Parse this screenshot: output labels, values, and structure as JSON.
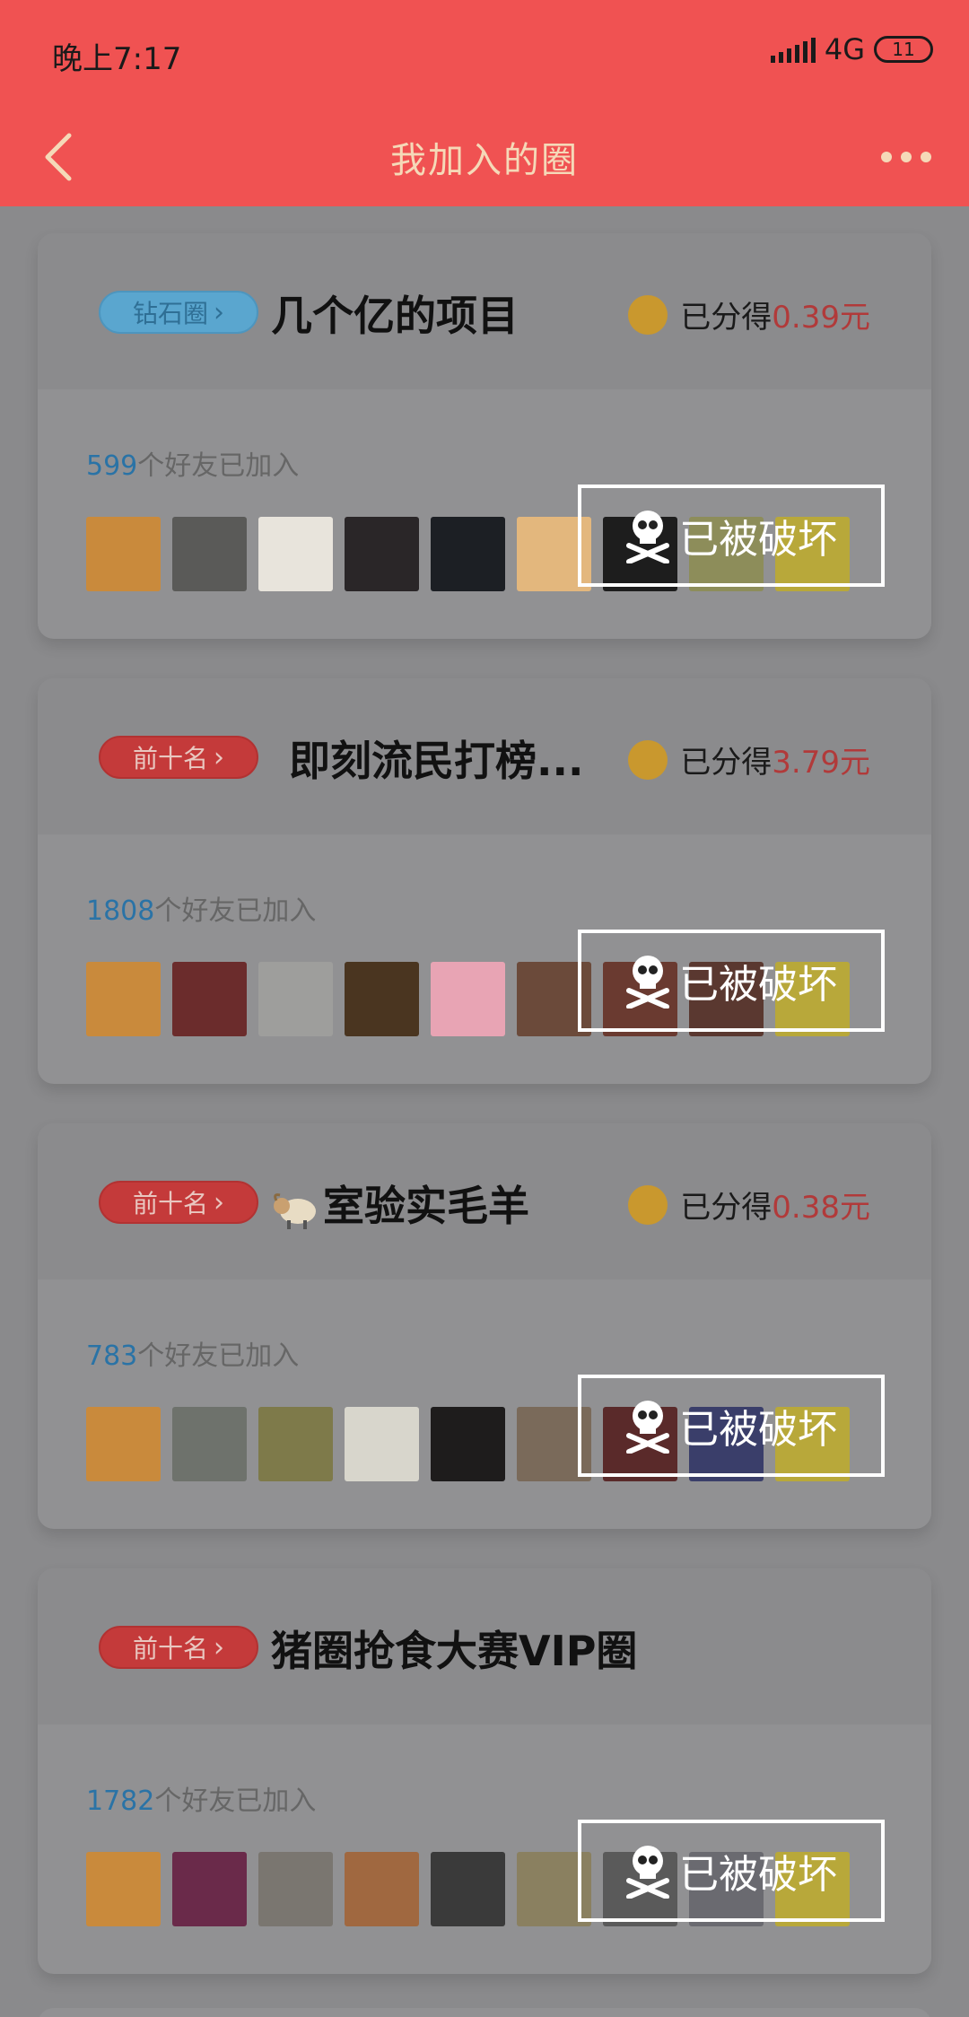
{
  "status": {
    "time": "晚上7:17",
    "network": "4G",
    "battery": "11"
  },
  "header": {
    "title": "我加入的圈"
  },
  "destroyed_label": "已被破坏",
  "friends_suffix": "个好友已加入",
  "earn_prefix": "已分得",
  "circles": [
    {
      "badge": "钻石圈",
      "badge_type": "diamond",
      "name": "几个亿的项目",
      "earn": "0.39元",
      "friends": "599",
      "avatars": [
        "#c98a3c",
        "#5a5a58",
        "#e8e4dc",
        "#2a2628",
        "#1c1f24",
        "#e3b77d",
        "#1d1d1d",
        "#8d8d5a",
        "#b8a83a"
      ]
    },
    {
      "badge": "前十名",
      "badge_type": "top",
      "name": "即刻流民打榜...",
      "earn": "3.79元",
      "friends": "1808",
      "avatars": [
        "#c98a3c",
        "#6b2c2c",
        "#9e9e9c",
        "#4a3520",
        "#e8a4b4",
        "#6b4a3a",
        "#6a3a30",
        "#5a3830",
        "#b8a83a"
      ]
    },
    {
      "badge": "前十名",
      "badge_type": "top",
      "name": "室验实毛羊",
      "earn": "0.38元",
      "friends": "783",
      "has_icon": true,
      "avatars": [
        "#c98a3c",
        "#6e726c",
        "#7e7a4a",
        "#d8d6cc",
        "#1e1c1c",
        "#7a6a5a",
        "#5a2a2a",
        "#3a3e6a",
        "#b8a83a"
      ]
    },
    {
      "badge": "前十名",
      "badge_type": "top",
      "name": "猪圈抢食大赛VIP圈",
      "earn": "",
      "friends": "1782",
      "avatars": [
        "#c98a3c",
        "#6a2a4a",
        "#7a7670",
        "#a06840",
        "#3a3a3a",
        "#8a8060",
        "#5a5a5a",
        "#6a6a70",
        "#b8a83a"
      ]
    }
  ]
}
